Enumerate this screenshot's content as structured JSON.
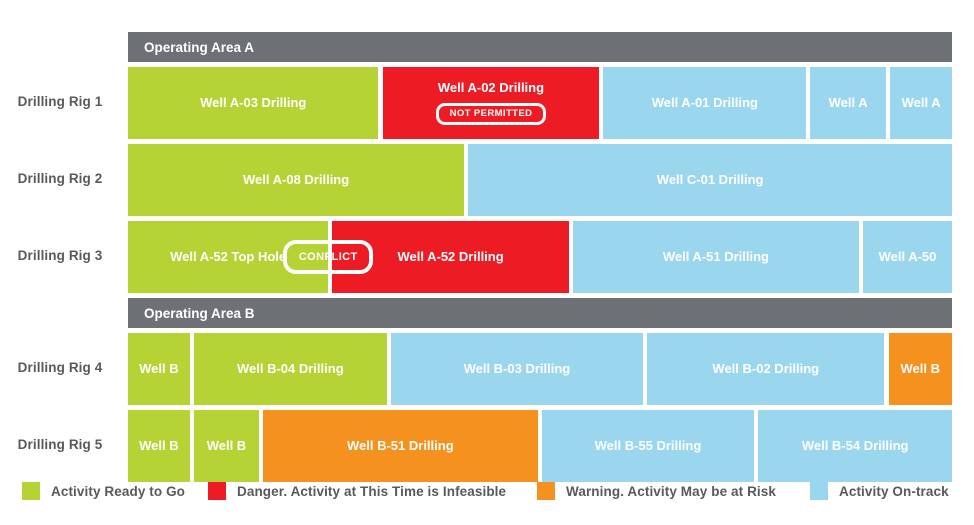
{
  "colors": {
    "green": "#b5d334",
    "red": "#ed1c24",
    "orange": "#f5911e",
    "blue": "#9ad7ef",
    "group_band": "#6d7175",
    "text": "#58595b",
    "background": "#ffffff"
  },
  "chart_data": {
    "type": "bar",
    "title": "",
    "xlabel": "",
    "ylabel": "",
    "grid": false,
    "legend_position": "bottom",
    "categories": [
      "Drilling Rig 1",
      "Drilling Rig 2",
      "Drilling Rig 3",
      "Drilling Rig 4",
      "Drilling Rig 5"
    ],
    "groups": [
      {
        "label": "Operating Area A",
        "rows": [
          "Drilling Rig 1",
          "Drilling Rig 2",
          "Drilling Rig 3"
        ]
      },
      {
        "label": "Operating Area B",
        "rows": [
          "Drilling Rig 4",
          "Drilling Rig 5"
        ]
      }
    ],
    "legend": [
      {
        "label": "Activity Ready to Go",
        "color": "#b5d334",
        "status": "ready"
      },
      {
        "label": "Danger. Activity at This Time is Infeasible",
        "color": "#ed1c24",
        "status": "danger"
      },
      {
        "label": "Warning. Activity May be at Risk",
        "color": "#f5911e",
        "status": "warning"
      },
      {
        "label": "Activity On-track",
        "color": "#9ad7ef",
        "status": "ontrack"
      }
    ],
    "rows": [
      {
        "label": "Drilling Rig 1",
        "bars": [
          {
            "label": "Well A-03 Drilling",
            "status": "ready",
            "start": 0,
            "end": 0.304
          },
          {
            "label": "Well A-02 Drilling",
            "status": "danger",
            "start": 0.309,
            "end": 0.572,
            "badge": "NOT PERMITTED"
          },
          {
            "label": "Well A-01 Drilling",
            "status": "ontrack",
            "start": 0.577,
            "end": 0.823
          },
          {
            "label": "Well A",
            "status": "ontrack",
            "start": 0.828,
            "end": 0.92
          },
          {
            "label": "Well A",
            "status": "ontrack",
            "start": 0.925,
            "end": 1.0
          }
        ]
      },
      {
        "label": "Drilling Rig 2",
        "bars": [
          {
            "label": "Well A-08 Drilling",
            "status": "ready",
            "start": 0,
            "end": 0.408
          },
          {
            "label": "Well C-01 Drilling",
            "status": "ontrack",
            "start": 0.413,
            "end": 1.0
          }
        ]
      },
      {
        "label": "Drilling Rig 3",
        "bars": [
          {
            "label": "Well A-52 Top Hole",
            "status": "ready",
            "start": 0,
            "end": 0.243
          },
          {
            "label": "Well A-52 Drilling",
            "status": "danger",
            "start": 0.248,
            "end": 0.535
          },
          {
            "label": "Well A-51 Drilling",
            "status": "ontrack",
            "start": 0.54,
            "end": 0.887
          },
          {
            "label": "Well A-50",
            "status": "ontrack",
            "start": 0.892,
            "end": 1.0
          }
        ],
        "floating_badge": {
          "label": "CONFLICT",
          "center": 0.243
        }
      },
      {
        "label": "Drilling Rig 4",
        "bars": [
          {
            "label": "Well B",
            "status": "ready",
            "start": 0,
            "end": 0.075
          },
          {
            "label": "Well B-04 Drilling",
            "status": "ready",
            "start": 0.08,
            "end": 0.314
          },
          {
            "label": "Well B-03 Drilling",
            "status": "ontrack",
            "start": 0.319,
            "end": 0.625
          },
          {
            "label": "Well B-02 Drilling",
            "status": "ontrack",
            "start": 0.63,
            "end": 0.918
          },
          {
            "label": "Well B",
            "status": "warning",
            "start": 0.923,
            "end": 1.0
          }
        ]
      },
      {
        "label": "Drilling Rig 5",
        "bars": [
          {
            "label": "Well B",
            "status": "ready",
            "start": 0,
            "end": 0.075
          },
          {
            "label": "Well B",
            "status": "ready",
            "start": 0.08,
            "end": 0.159
          },
          {
            "label": "Well B-51 Drilling",
            "status": "warning",
            "start": 0.164,
            "end": 0.497
          },
          {
            "label": "Well B-55 Drilling",
            "status": "ontrack",
            "start": 0.502,
            "end": 0.76
          },
          {
            "label": "Well B-54 Drilling",
            "status": "ontrack",
            "start": 0.765,
            "end": 1.0
          }
        ]
      }
    ]
  }
}
